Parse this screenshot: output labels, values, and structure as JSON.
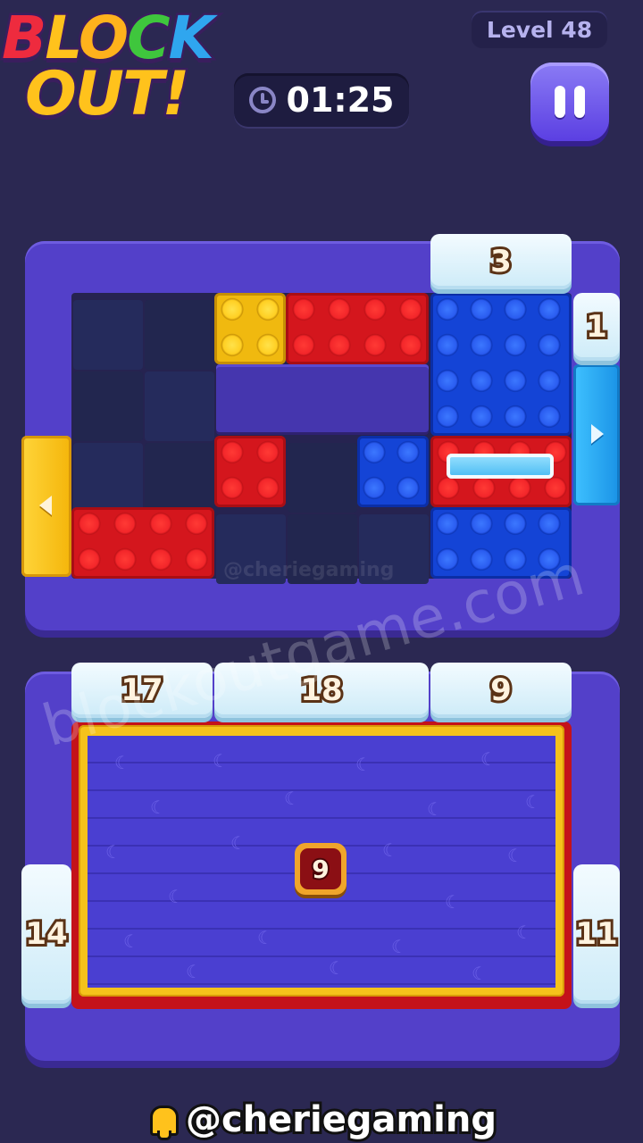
{
  "logo": {
    "line1": [
      "B",
      "L",
      "O",
      "C",
      "K"
    ],
    "line2": "OUT!"
  },
  "header": {
    "level": "Level 48",
    "timer": "01:25"
  },
  "board": {
    "top_tile": "3",
    "right_tile": "1",
    "bricks": [
      "yellow",
      "red",
      "red",
      "blue",
      "blue",
      "red",
      "blue"
    ]
  },
  "bin": {
    "top_tiles": [
      "17",
      "18",
      "9"
    ],
    "left_tile": "14",
    "right_tile": "11",
    "center_badge": "9"
  },
  "watermark": {
    "main": "blockoutgame.com",
    "small": "@cheriegaming"
  },
  "footer": {
    "handle": "@cheriegaming"
  },
  "colors": {
    "background": "#2b2852",
    "frame": "#5340c9",
    "red": "#d4161d",
    "blue": "#1444d6",
    "yellow": "#f0b90f",
    "ice": "#e6f6fd"
  }
}
